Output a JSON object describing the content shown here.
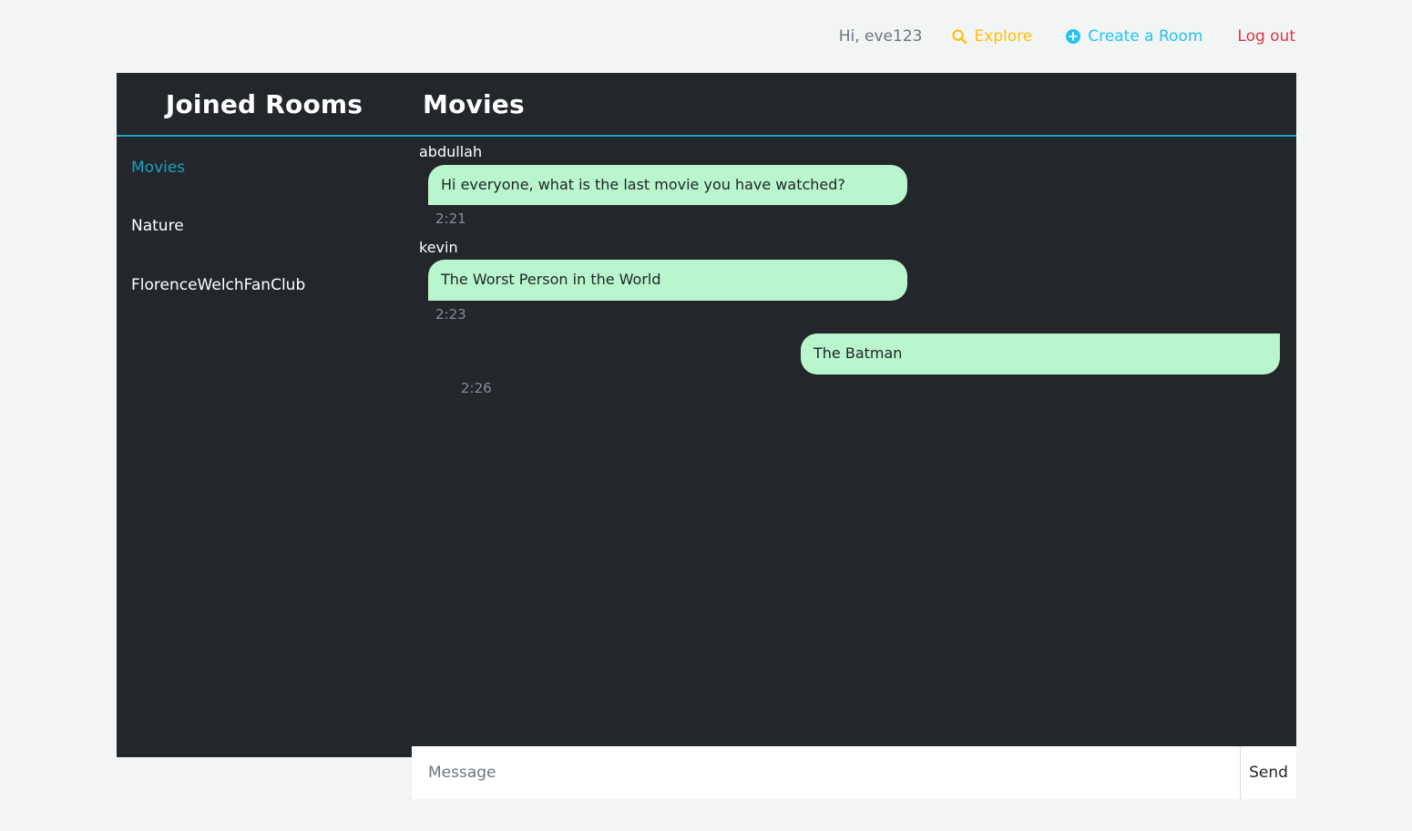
{
  "topnav": {
    "greeting": "Hi, eve123",
    "explore_label": "Explore",
    "explore_icon": "search-icon",
    "create_label": "Create a Room",
    "create_icon": "plus-circle-icon",
    "logout_label": "Log out",
    "colors": {
      "greeting": "#6c757d",
      "explore": "#ffc107",
      "create": "#22c3f0",
      "logout": "#dc3545"
    }
  },
  "header": {
    "rooms_title": "Joined Rooms",
    "room_name": "Movies",
    "divider_color": "#17a2c6"
  },
  "sidebar": {
    "rooms": [
      {
        "label": "Movies",
        "active": true
      },
      {
        "label": "Nature",
        "active": false
      },
      {
        "label": "FlorenceWelchFanClub",
        "active": false
      }
    ]
  },
  "chat": {
    "messages": [
      {
        "author": "abdullah",
        "text": "Hi everyone, what is the last movie you have watched?",
        "time": "2:21",
        "own": false
      },
      {
        "author": "kevin",
        "text": "The Worst Person in the World",
        "time": "2:23",
        "own": false
      },
      {
        "author": "",
        "text": "The Batman",
        "time": "2:26",
        "own": true
      }
    ],
    "bubble_color": "#b9f5cd"
  },
  "composer": {
    "placeholder": "Message",
    "value": "",
    "send_label": "Send"
  },
  "theme": {
    "page_background": "#f3f4f4",
    "panel_background": "#23262b"
  }
}
